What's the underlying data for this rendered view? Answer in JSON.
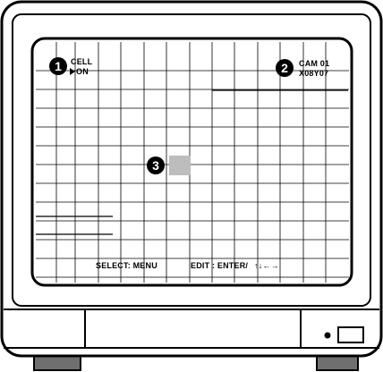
{
  "monitor": {
    "markers": [
      "1",
      "2",
      "3"
    ],
    "cell_label": "CELL",
    "cell_value": "ON",
    "camera_label": "CAM 01",
    "grid_size": "X08Y07",
    "footer_select": "SELECT: MENU",
    "footer_edit": "EDIT : ENTER/",
    "footer_arrows": "↑↓←→"
  },
  "colors": {
    "screen": "#ffffff",
    "bezel": "#ffffff",
    "selected_cell": "#bdbdbd",
    "feet": "#6f6f6f"
  },
  "icons": {
    "cell_cursor": "triangle-right-icon",
    "power_led": "power-led-icon",
    "power_button": "power-button-icon"
  }
}
